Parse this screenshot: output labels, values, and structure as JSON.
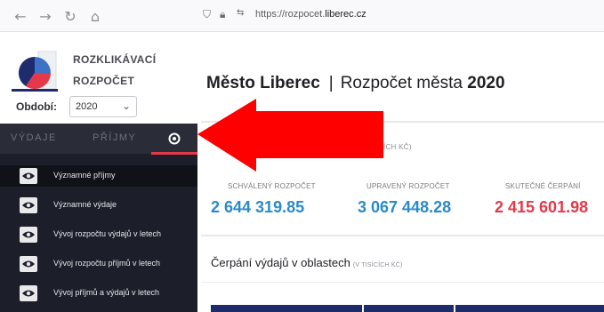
{
  "browser": {
    "url_prefix": "https://rozpocet.",
    "url_domain": "liberec.cz"
  },
  "header": {
    "brand_line1": "ROZKLIKÁVACÍ",
    "brand_line2": "ROZPOČET",
    "period_label": "Období:",
    "period_value": "2020"
  },
  "title": {
    "city": "Město Liberec",
    "separator": "|",
    "label": "Rozpočet města",
    "year": "2020"
  },
  "tabs": [
    "VÝDAJE",
    "PŘÍJMY"
  ],
  "menu": [
    {
      "label": "Významné příjmy",
      "icon": "eye-icon"
    },
    {
      "label": "Významné výdaje",
      "icon": "eye-icon"
    },
    {
      "label": "Vývoj rozpočtu výdajů v letech",
      "icon": "eye-icon"
    },
    {
      "label": "Vývoj rozpočtu příjmů v letech",
      "icon": "eye-icon"
    },
    {
      "label": "Vývoj příjmů a výdajů v letech",
      "icon": "eye-icon"
    }
  ],
  "panel_label_partial": "TISÍCÍCH KČ)",
  "stats": [
    {
      "label": "SCHVÁLENÝ ROZPOČET",
      "value": "2 644 319.85",
      "color": "#2a8ac9"
    },
    {
      "label": "UPRAVENÝ ROZPOČET",
      "value": "3 067 448.28",
      "color": "#2a8ac9"
    },
    {
      "label": "SKUTEČNÉ ČERPÁNÍ",
      "value": "2 415 601.98",
      "color": "#e5394a"
    }
  ],
  "section": {
    "title": "Čerpání výdajů v oblastech",
    "subtitle": "(V TISÍCÍCH KČ)"
  },
  "colors": {
    "accent_red": "#e5394a",
    "arrow_red": "#ff0000",
    "sidebar_bg": "#1c1f29",
    "value_blue": "#2a8ac9"
  }
}
